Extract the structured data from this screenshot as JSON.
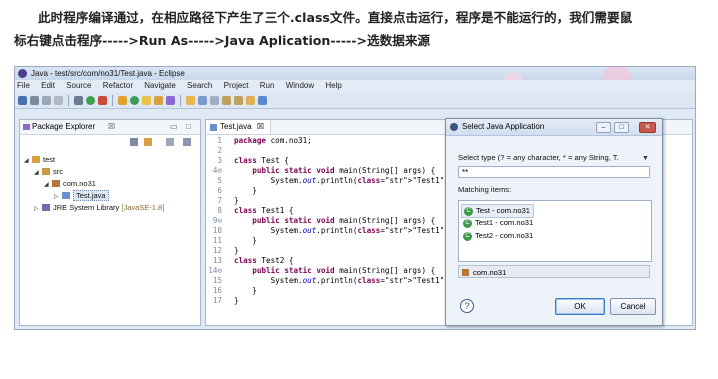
{
  "intro": {
    "line1": "此时程序编译通过，在相应路径下产生了三个.class文件。直接点击运行，程序是不能运行的，我们需要鼠",
    "line2": "标右键点击程序----->Run As----->Java Aplication----->选数据来源"
  },
  "window": {
    "title": "Java - test/src/com/no31/Test.java - Eclipse"
  },
  "menu": [
    "File",
    "Edit",
    "Source",
    "Refactor",
    "Navigate",
    "Search",
    "Project",
    "Run",
    "Window",
    "Help"
  ],
  "package_explorer": {
    "tab_label": "Package Explorer",
    "tree": {
      "project": "test",
      "src": "src",
      "package": "com.no31",
      "file": "Test.java",
      "jre": "JRE System Library",
      "jre_version": "[JavaSE-1.8]"
    }
  },
  "editor": {
    "tab_label": "Test.java",
    "lines": [
      {
        "n": "1",
        "text": "package com.no31;"
      },
      {
        "n": "2",
        "text": ""
      },
      {
        "n": "3",
        "text": "class Test {"
      },
      {
        "n": "4⊖",
        "text": "    public static void main(String[] args) {"
      },
      {
        "n": "5",
        "text": "        System.out.println(\"Test1\");"
      },
      {
        "n": "6",
        "text": "    }"
      },
      {
        "n": "7",
        "text": "}"
      },
      {
        "n": "8",
        "text": "class Test1 {"
      },
      {
        "n": "9⊖",
        "text": "    public static void main(String[] args) {"
      },
      {
        "n": "10",
        "text": "        System.out.println(\"Test1\");"
      },
      {
        "n": "11",
        "text": "    }"
      },
      {
        "n": "12",
        "text": "}"
      },
      {
        "n": "13",
        "text": "class Test2 {"
      },
      {
        "n": "14⊖",
        "text": "    public static void main(String[] args) {"
      },
      {
        "n": "15",
        "text": "        System.out.println(\"Test1\");"
      },
      {
        "n": "16",
        "text": "    }"
      },
      {
        "n": "17",
        "text": "}"
      }
    ]
  },
  "dialog": {
    "title": "Select Java Application",
    "select_type_label": "Select type (? = any character, * = any String, T.",
    "filter_value": "**",
    "matching_label": "Matching items:",
    "items": [
      "Test - com.no31",
      "Test1 - com.no31",
      "Test2 - com.no31"
    ],
    "package_label": "com.no31",
    "ok_label": "OK",
    "cancel_label": "Cancel"
  }
}
